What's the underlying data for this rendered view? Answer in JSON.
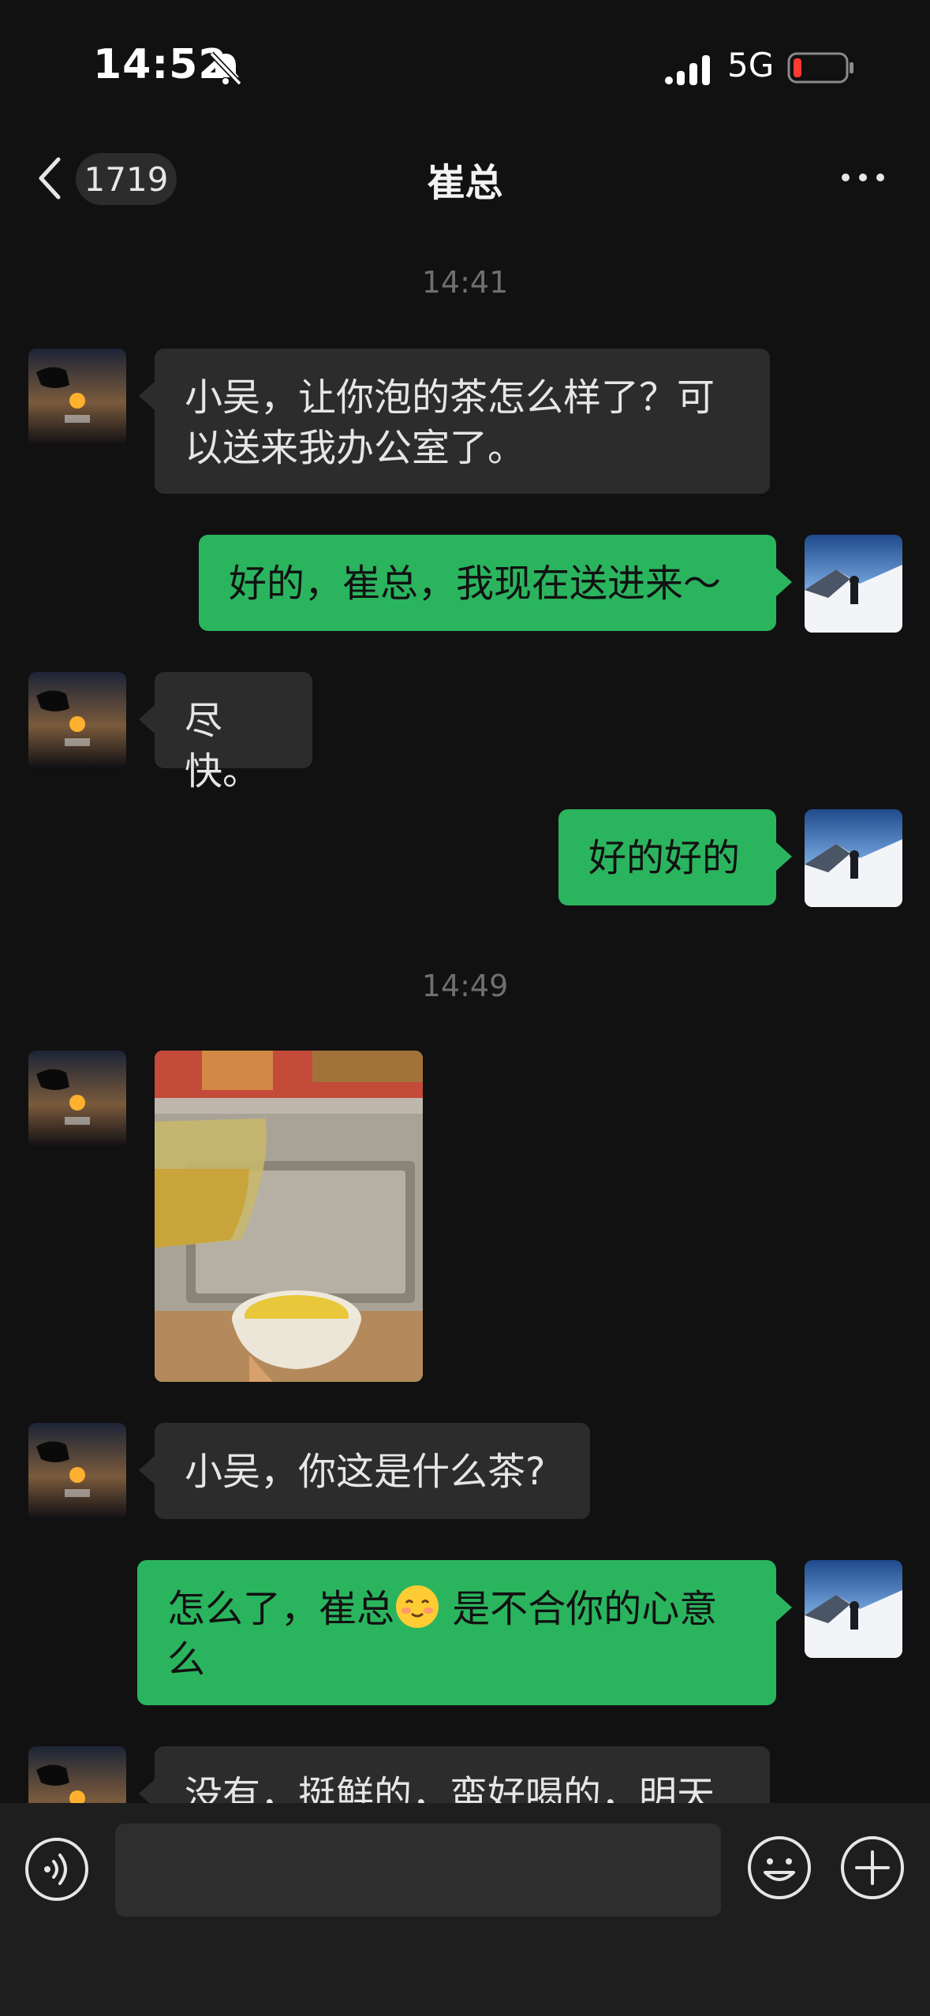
{
  "status_bar": {
    "time": "14:52",
    "network": "5G"
  },
  "nav": {
    "unread_count": "1719",
    "title": "崔总"
  },
  "timestamps": [
    "14:41",
    "14:49"
  ],
  "messages": [
    {
      "from": "contact",
      "text": "小吴，让你泡的茶怎么样了？可以送来我办公室了。"
    },
    {
      "from": "me",
      "text": "好的，崔总，我现在送进来～"
    },
    {
      "from": "contact",
      "text": "尽快。"
    },
    {
      "from": "me",
      "text": "好的好的"
    },
    {
      "from": "contact",
      "type": "image",
      "content": "photo of tea"
    },
    {
      "from": "contact",
      "text": "小吴，你这是什么茶?"
    },
    {
      "from": "me",
      "text_before": "怎么了，崔总",
      "emoji": "blushing-face",
      "text_after": " 是不合你的心意么"
    },
    {
      "from": "contact",
      "text": "没有，挺鲜的，蛮好喝的，明天"
    }
  ],
  "colors": {
    "outgoing_bubble": "#2bb45e",
    "incoming_bubble": "#2c2c2c",
    "background": "#111111"
  }
}
